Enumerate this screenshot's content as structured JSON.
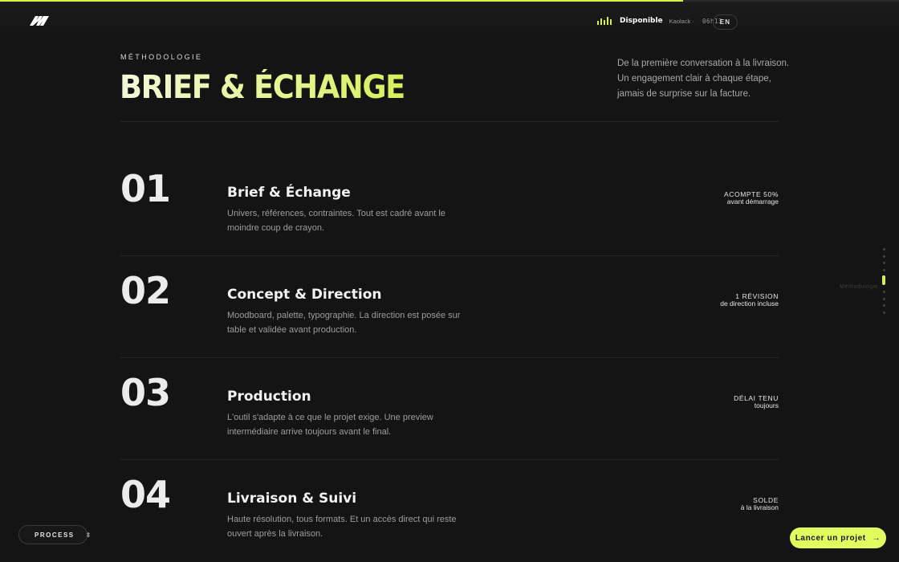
{
  "progress": {
    "fraction": 0.76,
    "color": "#d4f24a"
  },
  "header": {
    "logo_icon": "brand-logo-icon",
    "status": {
      "label": "Disponible",
      "place": "Kaolack ·",
      "time": "06h13",
      "icon": "signal-bars-icon"
    },
    "lang_label": "EN"
  },
  "hero": {
    "eyebrow": "MÉTHODOLOGIE",
    "title": "BRIEF & ÉCHANGE",
    "intro": "De la première conversation à la livraison. Un engagement clair à chaque étape, jamais de surprise sur la facture."
  },
  "steps": [
    {
      "number": "01",
      "title": "Brief & Échange",
      "desc": "Univers, références, contraintes. Tout est cadré avant le moindre coup de crayon.",
      "meta_top": "ACOMPTE 50%",
      "meta_bottom": "avant démarrage"
    },
    {
      "number": "02",
      "title": "Concept & Direction",
      "desc": "Moodboard, palette, typographie. La direction est posée sur table et validée avant production.",
      "meta_top": "1 RÉVISION",
      "meta_bottom": "de direction incluse"
    },
    {
      "number": "03",
      "title": "Production",
      "desc": "L'outil s'adapte à ce que le projet exige. Une preview intermédiaire arrive toujours avant le final.",
      "meta_top": "DÉLAI TENU",
      "meta_bottom": "toujours"
    },
    {
      "number": "04",
      "title": "Livraison & Suivi",
      "desc": "Haute résolution, tous formats. Et un accès direct qui reste ouvert après la livraison.",
      "meta_top": "SOLDE",
      "meta_bottom": "à la livraison"
    }
  ],
  "sidenav": {
    "label": "Méthodologie",
    "count": 9,
    "active_index": 4
  },
  "footer": {
    "process_label": "PROCESS",
    "process_icon": "chevron-updown-icon",
    "cta_label": "Lancer un projet",
    "cta_icon": "arrow-right-icon"
  },
  "colors": {
    "accent": "#d4f24a",
    "background": "#141414"
  }
}
